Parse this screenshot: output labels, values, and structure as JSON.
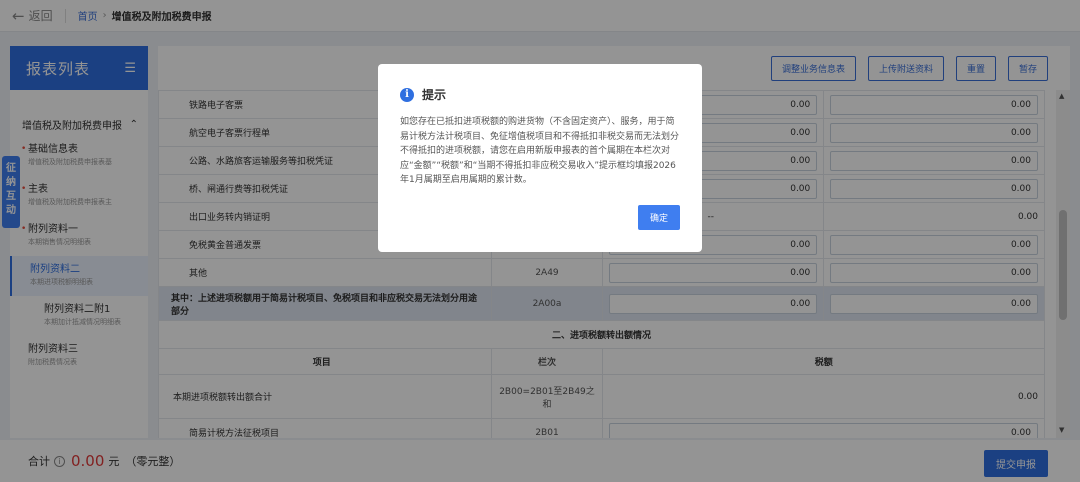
{
  "header": {
    "back_label": "返回",
    "crumb_home": "首页",
    "crumb_sep": "›",
    "crumb_current": "增值税及附加税费申报"
  },
  "sidebar": {
    "title": "报表列表",
    "group_label": "增值税及附加税费申报",
    "items": [
      {
        "name": "基础信息表",
        "sub": "增值税及附加税费申报表基",
        "marked": true
      },
      {
        "name": "主表",
        "sub": "增值税及附加税费申报表主",
        "marked": true
      },
      {
        "name": "附列资料一",
        "sub": "本期销售情况明细表",
        "marked": true
      },
      {
        "name": "附列资料二",
        "sub": "本期进项税额明细表",
        "marked": false
      },
      {
        "name": "附列资料二附1",
        "sub": "本期加计抵减情况明细表",
        "marked": false
      },
      {
        "name": "附列资料三",
        "sub": "附加税费情况表",
        "marked": false
      }
    ],
    "float_tag": "征纳互动"
  },
  "toolbar": {
    "adjust": "调整业务信息表",
    "upload": "上传附送资料",
    "reset": "重置",
    "save": "暂存"
  },
  "table": {
    "rows": [
      {
        "label": "铁路电子客票",
        "code": "",
        "amount": "0.00",
        "tax": "0.00"
      },
      {
        "label": "航空电子客票行程单",
        "code": "",
        "amount": "0.00",
        "tax": "0.00"
      },
      {
        "label": "公路、水路旅客运输服务等扣税凭证",
        "code": "",
        "amount": "0.00",
        "tax": "0.00"
      },
      {
        "label": "桥、闸通行费等扣税凭证",
        "code": "",
        "amount": "0.00",
        "tax": "0.00"
      },
      {
        "label": "出口业务转内销证明",
        "code": "",
        "amount": "--",
        "tax": "0.00"
      },
      {
        "label": "免税黄金普通发票",
        "code": "",
        "amount": "0.00",
        "tax": "0.00"
      },
      {
        "label": "其他",
        "code": "2A49",
        "amount": "0.00",
        "tax": "0.00"
      }
    ],
    "highlight_row": {
      "label": "其中：上述进项税额用于简易计税项目、免税项目和非应税交易无法划分用途部分",
      "code": "2A00a",
      "amount": "0.00",
      "tax": "0.00"
    },
    "section2_title": "二、进项税额转出额情况",
    "section2_headers": {
      "item": "项目",
      "col": "栏次",
      "tax": "税额"
    },
    "section2_total": {
      "label": "本期进项税额转出额合计",
      "code": "2B00=2B01至2B49之和",
      "tax": "0.00"
    },
    "section2_partial": {
      "label": "简易计税方法征税项目",
      "code": "2B01",
      "tax": "0.00"
    }
  },
  "footer": {
    "total_label": "合计",
    "amount": "0.00",
    "unit": "元",
    "caps": "（零元整）",
    "submit": "提交申报"
  },
  "dialog": {
    "title": "提示",
    "body": "如您存在已抵扣进项税额的购进货物（不含固定资产）、服务，用于简易计税方法计税项目、免征增值税项目和不得抵扣非税交易而无法划分不得抵扣的进项税额，请您在启用新版申报表的首个属期在本栏次对应“金额”“税额”和“当期不得抵扣非应税交易收入”提示框均填报2026年1月属期至启用属期的累计数。",
    "confirm": "确定"
  },
  "colors": {
    "primary": "#2f6fe0",
    "danger": "#e03a3a",
    "highlight_row": "#dfe6f2"
  }
}
